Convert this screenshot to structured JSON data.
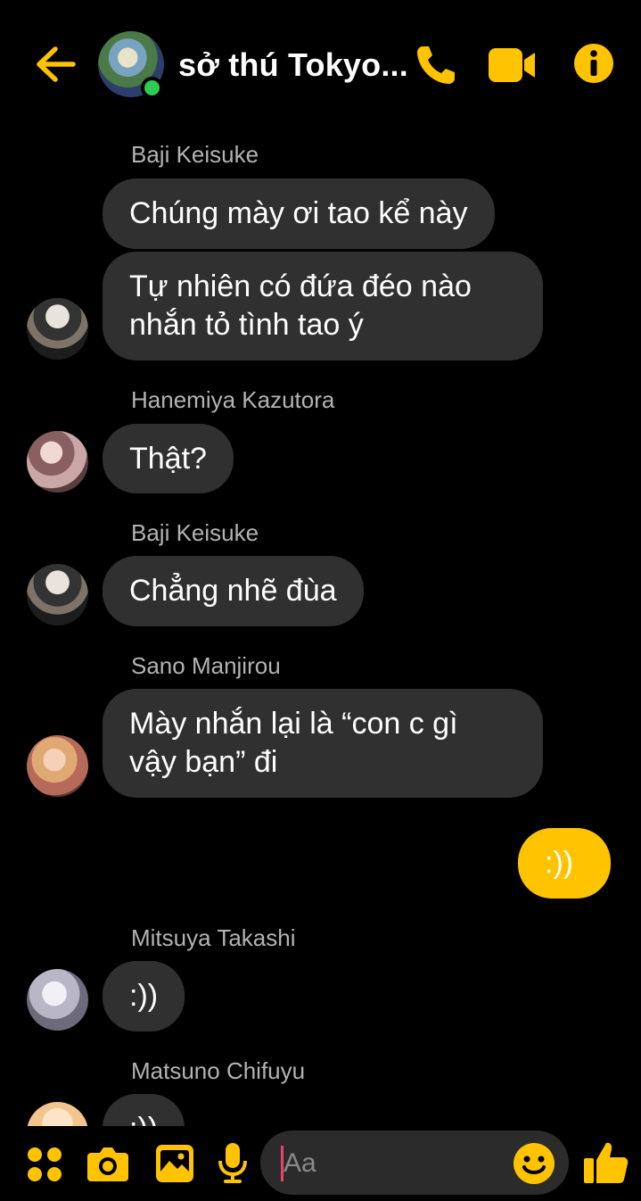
{
  "header": {
    "title": "sở thú Tokyo...",
    "back_icon": "arrow-left-icon",
    "call_icon": "phone-icon",
    "video_icon": "video-camera-icon",
    "info_icon": "info-icon",
    "accent_color": "#ffc300",
    "online": true
  },
  "messages": [
    {
      "sender": "Baji Keisuke",
      "texts": [
        "Chúng mày ơi tao kể này",
        "Tự nhiên có đứa đéo nào\nnhắn tỏ tình tao ý"
      ]
    },
    {
      "sender": "Hanemiya Kazutora",
      "texts": [
        "Thật?"
      ]
    },
    {
      "sender": "Baji Keisuke",
      "texts": [
        "Chẳng nhẽ đùa"
      ]
    },
    {
      "sender": "Sano Manjirou",
      "texts": [
        "Mày nhắn lại là “con c gì\nvậy bạn” đi"
      ]
    },
    {
      "sender": "me",
      "texts": [
        ":))"
      ]
    },
    {
      "sender": "Mitsuya Takashi",
      "texts": [
        ":))"
      ]
    },
    {
      "sender": "Matsuno Chifuyu",
      "texts": [
        ":))"
      ]
    }
  ],
  "composer": {
    "placeholder": "Aa",
    "icons": [
      "menu-dots-icon",
      "camera-icon",
      "image-icon",
      "microphone-icon",
      "emoji-icon",
      "thumbs-up-icon"
    ]
  }
}
